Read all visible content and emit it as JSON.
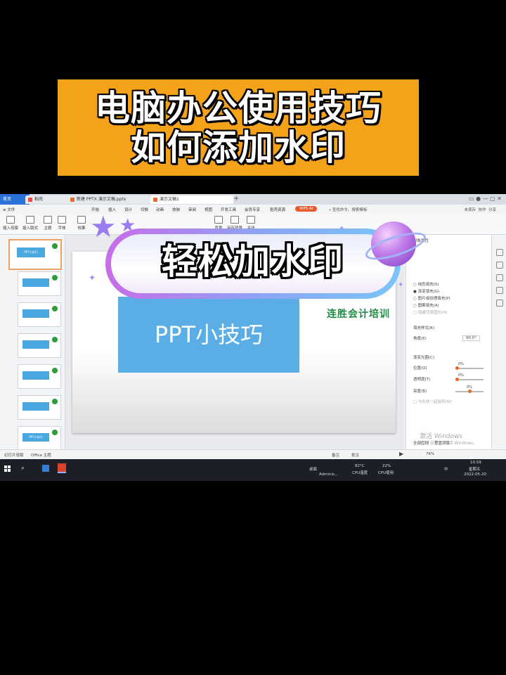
{
  "banner": {
    "line1": "电脑办公使用技巧",
    "line2": "如何添加水印",
    "bg_color": "#f5a21b"
  },
  "overlay": {
    "title": "轻松加水印"
  },
  "window": {
    "tabs": [
      {
        "label": "首页",
        "active": true
      },
      {
        "label": "稻壳",
        "icon": "docer-icon"
      },
      {
        "label": "新建 PPTX 演示文稿.pptx",
        "icon": "pptx-icon"
      },
      {
        "label": "演示文稿1",
        "icon": "pptx-icon"
      }
    ],
    "new_tab": "+"
  },
  "menu": {
    "file": "文件",
    "items": [
      "开始",
      "插入",
      "设计",
      "切换",
      "动画",
      "放映",
      "审阅",
      "视图",
      "开发工具",
      "会员专享",
      "稻壳资源"
    ],
    "ai_badge": "WPS AI",
    "search_placeholder": "查找命令、搜索模板",
    "right_items": [
      "未保存",
      "协作",
      "分享"
    ]
  },
  "ribbon": {
    "buttons": [
      "插入母版",
      "插入版式",
      "主题",
      "字体",
      "颜色",
      "效果",
      "背景",
      "另存背景",
      "版式",
      "背景",
      "另存背景",
      "关闭"
    ]
  },
  "thumbnails": {
    "count": 7,
    "labels": [
      "PPT小技巧",
      "PPT小技巧"
    ]
  },
  "slide": {
    "title": "PPT小技巧",
    "brand": "连胜会计培训"
  },
  "right_panel": {
    "header": "对象属性",
    "options": [
      "纯色填充(S)",
      "渐变填充(G)",
      "图片或纹理填充(P)",
      "图案填充(A)",
      "隐藏背景图形(H)"
    ],
    "section": "填充样式(R)",
    "angle_label": "角度(E)",
    "angle_value": "90.0°",
    "stops_label": "渐变光圈(C)",
    "rows": [
      {
        "label": "位置(O)",
        "value": "0%"
      },
      {
        "label": "透明度(T)",
        "value": "0%"
      },
      {
        "label": "亮度(B)",
        "value": "0%"
      }
    ],
    "rotate": "与形状一起旋转(W)",
    "apply_all": "全部应用",
    "reset": "重置背景"
  },
  "watermark": {
    "line1": "激活 Windows",
    "line2": "转到\"设置\"以激活 Windows。"
  },
  "status": {
    "left": "幻灯片母版",
    "theme": "Office 主题",
    "notes": "备注",
    "comment": "批注",
    "zoom": "76%"
  },
  "taskbar": {
    "desktop": "桌面",
    "admin": "Adminis...",
    "cpu_temp_value": "82°C",
    "cpu_temp_label": "CPU温度",
    "cpu_usage_value": "22%",
    "cpu_usage_label": "CPU使用",
    "lang": "中",
    "time": "10:59",
    "weekday": "星期五",
    "date": "2022-05-20"
  }
}
